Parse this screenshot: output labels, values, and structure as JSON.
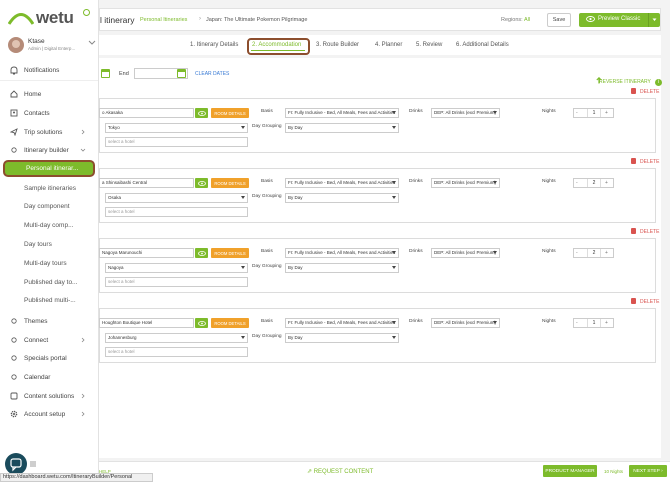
{
  "app": {
    "logo_text": "wetu"
  },
  "user": {
    "name": "Ktase",
    "role": "Admin | Digital Enterp..."
  },
  "sidebar": {
    "notifications": "Notifications",
    "items": [
      {
        "label": "Home",
        "icon": "home-icon"
      },
      {
        "label": "Contacts",
        "icon": "contacts-icon"
      },
      {
        "label": "Trip solutions",
        "icon": "plane-icon"
      },
      {
        "label": "Itinerary builder",
        "icon": "circle-icon"
      }
    ],
    "builder_subitems": [
      "Personal itinerar...",
      "Sample itineraries",
      "Day component",
      "Multi-day comp...",
      "Day tours",
      "Multi-day tours",
      "Published day to...",
      "Published multi-..."
    ],
    "bottom_items": [
      {
        "label": "Themes",
        "icon": "circle-icon"
      },
      {
        "label": "Connect",
        "icon": "circle-icon"
      },
      {
        "label": "Specials portal",
        "icon": "circle-icon"
      },
      {
        "label": "Calendar",
        "icon": "circle-icon"
      },
      {
        "label": "Content solutions",
        "icon": "content-icon"
      },
      {
        "label": "Account setup",
        "icon": "gear-icon"
      }
    ]
  },
  "header": {
    "title": "l itinerary",
    "breadcrumb_link": "Personal Itineraries",
    "breadcrumb_sep": "›",
    "breadcrumb_current": "Japan: The Ultimate Pokemon Pilgrimage",
    "regions_label": "Regions:",
    "regions_value": "All",
    "save_label": "Save",
    "preview_label": "Preview Classic"
  },
  "steps": [
    "1. Itinerary Details",
    "2. Accommodation",
    "3. Route Builder",
    "4. Planner",
    "5. Review",
    "6. Additional Details"
  ],
  "active_step": 1,
  "dates": {
    "end_label": "End",
    "clear_label": "CLEAR DATES",
    "reverse_label": "REVERSE ITINERARY"
  },
  "labels": {
    "delete": "DELETE",
    "room_details": "ROOM DETAILS",
    "basis": "Basis",
    "day_grouping": "Day Grouping",
    "drinks": "Drinks",
    "nights": "Nights",
    "select_hotel": "select a hotel",
    "basis_value": "FI: Fully Inclusive - Bed, All Meals, Fees and Activities",
    "day_grouping_value": "By Day",
    "drinks_value": "DEP: All Drinks (excl Premium)"
  },
  "stops": [
    {
      "hotel": "o Akasaka",
      "location": "Tokyo",
      "nights": "1"
    },
    {
      "hotel": "a Shinsaibashi Central",
      "location": "Osaka",
      "nights": "2"
    },
    {
      "hotel": "Nagoya Marunouchi",
      "location": "Nagoya",
      "nights": "2"
    },
    {
      "hotel": "Houghton Boutique Hotel",
      "location": "Johannesburg",
      "nights": "1"
    }
  ],
  "footer": {
    "help": "HELP",
    "request_content": "REQUEST CONTENT",
    "product_manager": "PRODUCT MANAGER",
    "nights_total": "10 Nights",
    "next_step": "NEXT STEP"
  },
  "status_url": "https://dashboard.wetu.com/ItineraryBuilder/Personal",
  "colors": {
    "accent": "#7dbb2b",
    "orange": "#f0a12b",
    "danger": "#d9534f",
    "highlight": "#8c4e2d"
  }
}
